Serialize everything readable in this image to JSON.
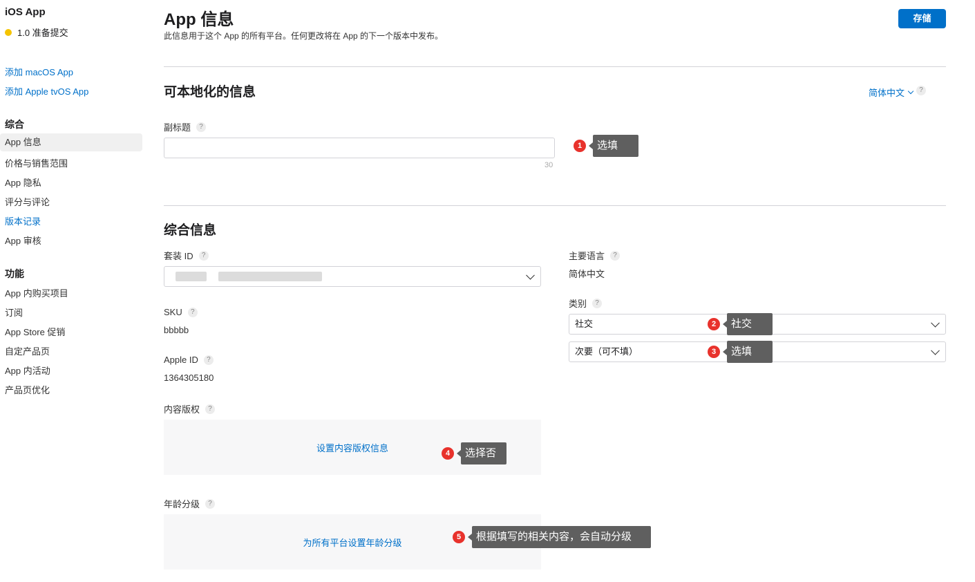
{
  "sidebar": {
    "app_title": "iOS App",
    "status": "1.0 准备提交",
    "add_links": [
      "添加 macOS App",
      "添加 Apple tvOS App"
    ],
    "general_heading": "综合",
    "general_items": [
      "App 信息",
      "价格与销售范围",
      "App 隐私",
      "评分与评论",
      "版本记录",
      "App 审核"
    ],
    "features_heading": "功能",
    "features_items": [
      "App 内购买项目",
      "订阅",
      "App Store 促销",
      "自定产品页",
      "App 内活动",
      "产品页优化"
    ],
    "active_item": "App 信息"
  },
  "header": {
    "title": "App 信息",
    "description": "此信息用于这个 App 的所有平台。任何更改将在 App 的下一个版本中发布。",
    "save_label": "存储"
  },
  "localizable": {
    "title": "可本地化的信息",
    "language_selector": "简体中文",
    "subtitle_label": "副标题",
    "subtitle_value": "",
    "subtitle_counter": "30"
  },
  "general": {
    "title": "综合信息",
    "bundle_id_label": "套装 ID",
    "sku_label": "SKU",
    "sku_value": "bbbbb",
    "apple_id_label": "Apple ID",
    "apple_id_value": "1364305180",
    "content_rights_label": "内容版权",
    "content_rights_link": "设置内容版权信息",
    "age_rating_label": "年龄分级",
    "age_rating_link": "为所有平台设置年龄分级",
    "primary_language_label": "主要语言",
    "primary_language_value": "简体中文",
    "category_label": "类别",
    "primary_category": "社交",
    "secondary_category": "次要（可不填）"
  },
  "annotations": [
    {
      "num": "1",
      "text": "选填"
    },
    {
      "num": "2",
      "text": "社交"
    },
    {
      "num": "3",
      "text": "选填"
    },
    {
      "num": "4",
      "text": "选择否"
    },
    {
      "num": "5",
      "text": "根据填写的相关内容，会自动分级"
    }
  ],
  "colors": {
    "accent": "#0070c9",
    "annotation_badge": "#e8322c",
    "annotation_box": "#5f5f5f",
    "status_dot": "#f5c400"
  }
}
